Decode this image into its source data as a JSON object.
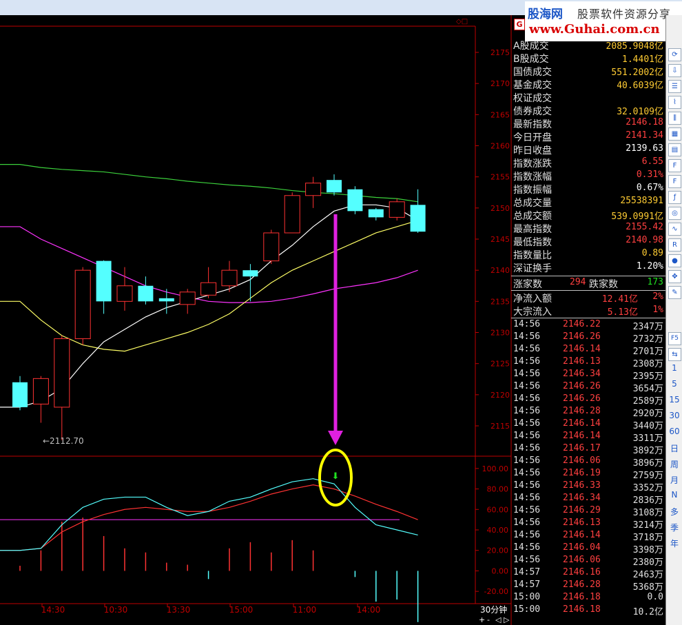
{
  "logo": {
    "brand": "股海网",
    "slogan": "股票软件资源分享",
    "url": "www.Guhai.com.cn"
  },
  "g_button": "G",
  "market_stats": [
    {
      "label": "A股成交",
      "value": "2085.9048亿",
      "color": "#ffcc33"
    },
    {
      "label": "B股成交",
      "value": "1.4401亿",
      "color": "#ffcc33"
    },
    {
      "label": "国债成交",
      "value": "551.2002亿",
      "color": "#ffcc33"
    },
    {
      "label": "基金成交",
      "value": "40.6039亿",
      "color": "#ffcc33"
    },
    {
      "label": "权证成交",
      "value": "",
      "color": "#ffcc33"
    },
    {
      "label": "债券成交",
      "value": "32.0109亿",
      "color": "#ffcc33"
    },
    {
      "label": "最新指数",
      "value": "2146.18",
      "color": "#ff4040"
    },
    {
      "label": "今日开盘",
      "value": "2141.34",
      "color": "#ff4040"
    },
    {
      "label": "昨日收盘",
      "value": "2139.63",
      "color": "#ffffff"
    },
    {
      "label": "指数涨跌",
      "value": "6.55",
      "color": "#ff4040"
    },
    {
      "label": "指数涨幅",
      "value": "0.31%",
      "color": "#ff4040"
    },
    {
      "label": "指数振幅",
      "value": "0.67%",
      "color": "#ffffff"
    },
    {
      "label": "总成交量",
      "value": "25538391",
      "color": "#ffcc33"
    },
    {
      "label": "总成交额",
      "value": "539.0991亿",
      "color": "#ffcc33"
    },
    {
      "label": "最高指数",
      "value": "2155.42",
      "color": "#ff4040"
    },
    {
      "label": "最低指数",
      "value": "2140.98",
      "color": "#ff4040"
    },
    {
      "label": "指数量比",
      "value": "0.89",
      "color": "#ffcc33"
    },
    {
      "label": "深证换手",
      "value": "1.20%",
      "color": "#ffffff"
    }
  ],
  "breadth": {
    "up_label": "涨家数",
    "up_value": "294",
    "down_label": "跌家数",
    "down_value": "173"
  },
  "flows": [
    {
      "label": "净流入额",
      "value": "12.41亿",
      "pct": "2%"
    },
    {
      "label": "大宗流入",
      "value": "5.13亿",
      "pct": "1%"
    }
  ],
  "ticks": [
    {
      "time": "14:56",
      "price": "2146.22",
      "vol": "2347万"
    },
    {
      "time": "14:56",
      "price": "2146.26",
      "vol": "2732万"
    },
    {
      "time": "14:56",
      "price": "2146.14",
      "vol": "2701万"
    },
    {
      "time": "14:56",
      "price": "2146.13",
      "vol": "2308万"
    },
    {
      "time": "14:56",
      "price": "2146.34",
      "vol": "2395万"
    },
    {
      "time": "14:56",
      "price": "2146.26",
      "vol": "3654万"
    },
    {
      "time": "14:56",
      "price": "2146.26",
      "vol": "2589万"
    },
    {
      "time": "14:56",
      "price": "2146.28",
      "vol": "2920万"
    },
    {
      "time": "14:56",
      "price": "2146.14",
      "vol": "3440万"
    },
    {
      "time": "14:56",
      "price": "2146.14",
      "vol": "3311万"
    },
    {
      "time": "14:56",
      "price": "2146.17",
      "vol": "3892万"
    },
    {
      "time": "14:56",
      "price": "2146.06",
      "vol": "3896万"
    },
    {
      "time": "14:56",
      "price": "2146.19",
      "vol": "2759万"
    },
    {
      "time": "14:56",
      "price": "2146.33",
      "vol": "3352万"
    },
    {
      "time": "14:56",
      "price": "2146.34",
      "vol": "2836万"
    },
    {
      "time": "14:56",
      "price": "2146.29",
      "vol": "3108万"
    },
    {
      "time": "14:56",
      "price": "2146.13",
      "vol": "3214万"
    },
    {
      "time": "14:56",
      "price": "2146.14",
      "vol": "3718万"
    },
    {
      "time": "14:56",
      "price": "2146.04",
      "vol": "3398万"
    },
    {
      "time": "14:56",
      "price": "2146.06",
      "vol": "2380万"
    },
    {
      "time": "14:57",
      "price": "2146.16",
      "vol": "2463万"
    },
    {
      "time": "14:57",
      "price": "2146.28",
      "vol": "5368万"
    },
    {
      "time": "15:00",
      "price": "2146.18",
      "vol": "0.0"
    },
    {
      "time": "15:00",
      "price": "2146.18",
      "vol": "10.2亿"
    }
  ],
  "icon_labels": [
    "1",
    "5",
    "15",
    "30",
    "60",
    "日",
    "周",
    "月",
    "N",
    "多",
    "季",
    "年"
  ],
  "period_label": "30分钟",
  "controls": [
    "+",
    "-",
    "◁",
    "▷"
  ],
  "chart_data": {
    "type": "candlestick",
    "price_axis": {
      "ticks": [
        2115,
        2120,
        2125,
        2130,
        2135,
        2140,
        2145,
        2150,
        2155,
        2160,
        2165,
        2170,
        2175
      ],
      "ylim": [
        2111,
        2178
      ]
    },
    "time_axis": [
      "14:30",
      "10:30",
      "13:30",
      "15:00",
      "11:00",
      "14:00"
    ],
    "low_marker": "2112.70",
    "candles": [
      {
        "o": 2122.0,
        "h": 2123.0,
        "l": 2117.5,
        "c": 2118.0
      },
      {
        "o": 2118.5,
        "h": 2123.0,
        "l": 2115.5,
        "c": 2122.6
      },
      {
        "o": 2118.0,
        "h": 2129.5,
        "l": 2112.7,
        "c": 2129.0
      },
      {
        "o": 2129.0,
        "h": 2140.5,
        "l": 2128.0,
        "c": 2140.0
      },
      {
        "o": 2141.5,
        "h": 2141.6,
        "l": 2133.0,
        "c": 2135.0
      },
      {
        "o": 2135.0,
        "h": 2140.5,
        "l": 2133.5,
        "c": 2137.5
      },
      {
        "o": 2137.5,
        "h": 2139.0,
        "l": 2134.5,
        "c": 2135.0
      },
      {
        "o": 2135.5,
        "h": 2137.0,
        "l": 2133.0,
        "c": 2135.0
      },
      {
        "o": 2134.5,
        "h": 2137.0,
        "l": 2133.0,
        "c": 2136.5
      },
      {
        "o": 2136.0,
        "h": 2140.5,
        "l": 2135.5,
        "c": 2138.0
      },
      {
        "o": 2137.5,
        "h": 2141.5,
        "l": 2136.5,
        "c": 2140.0
      },
      {
        "o": 2140.0,
        "h": 2141.0,
        "l": 2135.0,
        "c": 2139.0
      },
      {
        "o": 2141.5,
        "h": 2146.5,
        "l": 2141.0,
        "c": 2146.0
      },
      {
        "o": 2146.0,
        "h": 2152.5,
        "l": 2146.0,
        "c": 2152.0
      },
      {
        "o": 2152.0,
        "h": 2155.0,
        "l": 2150.0,
        "c": 2154.0
      },
      {
        "o": 2154.5,
        "h": 2155.4,
        "l": 2152.0,
        "c": 2152.5
      },
      {
        "o": 2153.0,
        "h": 2153.5,
        "l": 2149.0,
        "c": 2149.5
      },
      {
        "o": 2149.8,
        "h": 2150.0,
        "l": 2148.0,
        "c": 2148.5
      },
      {
        "o": 2148.5,
        "h": 2151.5,
        "l": 2148.0,
        "c": 2151.0
      },
      {
        "o": 2150.5,
        "h": 2153.0,
        "l": 2146.0,
        "c": 2146.2
      }
    ],
    "ma_series": [
      {
        "color": "#3cd23c",
        "values": [
          2157.0,
          2156.5,
          2156.2,
          2156.0,
          2155.8,
          2155.4,
          2155.0,
          2154.7,
          2154.3,
          2154.0,
          2153.7,
          2153.5,
          2153.2,
          2152.8,
          2152.5,
          2152.3,
          2152.0,
          2151.7,
          2151.5,
          2151.0
        ]
      },
      {
        "color": "#ff33ff",
        "values": [
          2147.0,
          2145.0,
          2143.5,
          2142.0,
          2140.5,
          2139.0,
          2137.5,
          2136.5,
          2135.7,
          2135.0,
          2134.8,
          2134.8,
          2135.0,
          2135.5,
          2136.2,
          2137.0,
          2137.5,
          2138.0,
          2138.8,
          2140.0
        ]
      },
      {
        "color": "#ffff66",
        "values": [
          2135.0,
          2132.0,
          2129.5,
          2128.0,
          2127.3,
          2127.0,
          2128.0,
          2129.0,
          2130.0,
          2131.3,
          2133.0,
          2135.5,
          2138.0,
          2140.0,
          2141.5,
          2143.0,
          2144.5,
          2146.0,
          2147.0,
          2148.0
        ]
      },
      {
        "color": "#ffffff",
        "values": [
          2118.0,
          2119.0,
          2121.0,
          2125.0,
          2128.5,
          2130.5,
          2132.5,
          2134.0,
          2135.0,
          2136.0,
          2137.0,
          2138.5,
          2141.5,
          2144.0,
          2147.0,
          2149.5,
          2150.5,
          2150.5,
          2150.0,
          2148.0
        ]
      }
    ],
    "indicator": {
      "axis_ticks": [
        100.0,
        80.0,
        60.0,
        40.0,
        20.0,
        0.0,
        -20.0
      ],
      "ylim": [
        -32,
        112
      ],
      "k_line": [
        20,
        22,
        45,
        62,
        70,
        72,
        72,
        62,
        54,
        58,
        68,
        72,
        80,
        87,
        90,
        85,
        62,
        45,
        40,
        35
      ],
      "d_line": [
        20,
        22,
        38,
        48,
        55,
        60,
        62,
        60,
        58,
        58,
        62,
        68,
        75,
        80,
        84,
        80,
        73,
        65,
        58,
        50
      ],
      "threshold": 50,
      "bars": [
        5,
        20,
        48,
        52,
        34,
        22,
        18,
        8,
        6,
        -8,
        22,
        28,
        18,
        30,
        20,
        0,
        -6,
        -30,
        -28,
        -50
      ]
    },
    "annotation": {
      "arrow_from_candle": 15,
      "signal": "down"
    }
  }
}
